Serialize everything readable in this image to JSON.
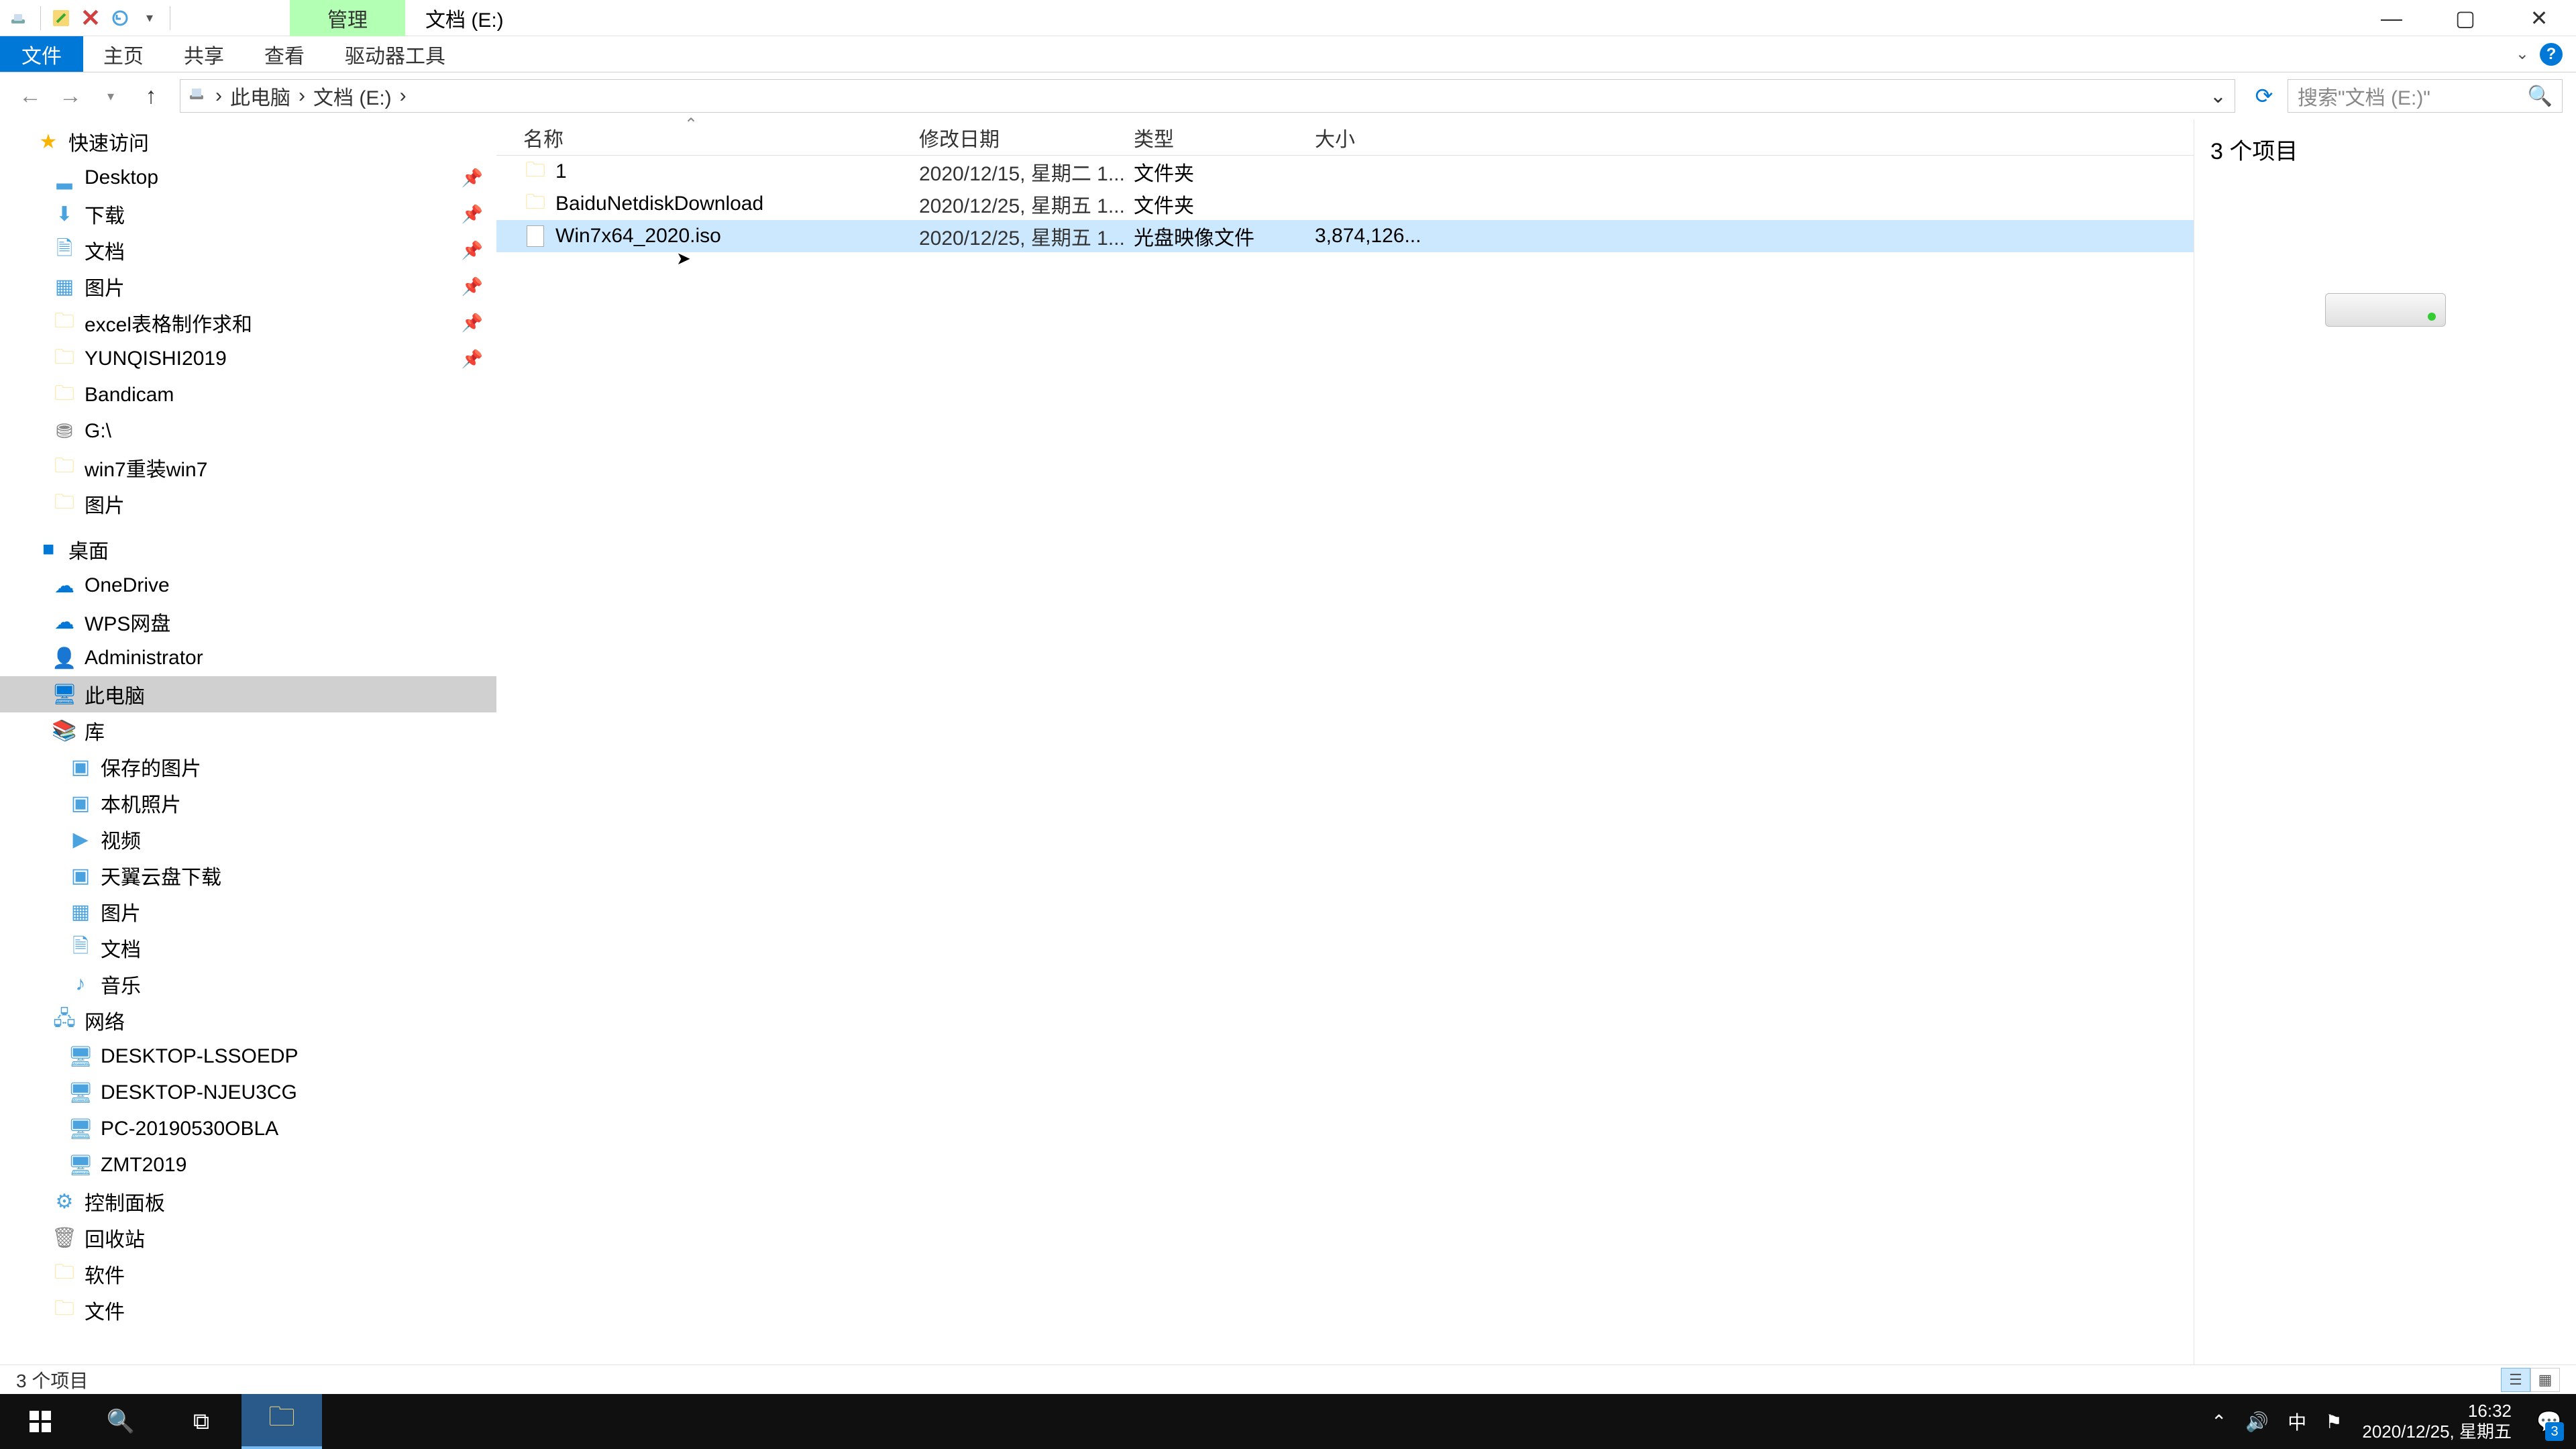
{
  "title_bar": {
    "contextual_label": "管理",
    "window_title": "文档 (E:)"
  },
  "ribbon": {
    "file": "文件",
    "home": "主页",
    "share": "共享",
    "view": "查看",
    "drive_tools": "驱动器工具"
  },
  "breadcrumb": {
    "root": "此电脑",
    "current": "文档 (E:)"
  },
  "search": {
    "placeholder": "搜索\"文档 (E:)\""
  },
  "columns": {
    "name": "名称",
    "date": "修改日期",
    "type": "类型",
    "size": "大小"
  },
  "files": [
    {
      "icon": "folder",
      "name": "1",
      "date": "2020/12/15, 星期二 1...",
      "type": "文件夹",
      "size": ""
    },
    {
      "icon": "folder",
      "name": "BaiduNetdiskDownload",
      "date": "2020/12/25, 星期五 1...",
      "type": "文件夹",
      "size": ""
    },
    {
      "icon": "file",
      "name": "Win7x64_2020.iso",
      "date": "2020/12/25, 星期五 1...",
      "type": "光盘映像文件",
      "size": "3,874,126..."
    }
  ],
  "nav": {
    "quick_access": "快速访问",
    "qa_items": [
      {
        "label": "Desktop",
        "icon": "desktop",
        "pinned": true
      },
      {
        "label": "下载",
        "icon": "downloads",
        "pinned": true
      },
      {
        "label": "文档",
        "icon": "documents",
        "pinned": true
      },
      {
        "label": "图片",
        "icon": "pictures",
        "pinned": true
      },
      {
        "label": "excel表格制作求和",
        "icon": "folder",
        "pinned": true
      },
      {
        "label": "YUNQISHI2019",
        "icon": "folder",
        "pinned": true
      },
      {
        "label": "Bandicam",
        "icon": "folder",
        "pinned": false
      },
      {
        "label": "G:\\",
        "icon": "drive",
        "pinned": false
      },
      {
        "label": "win7重装win7",
        "icon": "folder",
        "pinned": false
      },
      {
        "label": "图片",
        "icon": "folder",
        "pinned": false
      }
    ],
    "desktop": "桌面",
    "onedrive": "OneDrive",
    "wps": "WPS网盘",
    "admin": "Administrator",
    "thispc": "此电脑",
    "libraries": "库",
    "lib_items": [
      "保存的图片",
      "本机照片",
      "视频",
      "天翼云盘下载",
      "图片",
      "文档",
      "音乐"
    ],
    "network": "网络",
    "net_items": [
      "DESKTOP-LSSOEDP",
      "DESKTOP-NJEU3CG",
      "PC-20190530OBLA",
      "ZMT2019"
    ],
    "control_panel": "控制面板",
    "recycle": "回收站",
    "software": "软件",
    "files_folder": "文件"
  },
  "preview": {
    "count_label": "3 个项目"
  },
  "status": {
    "items": "3 个项目"
  },
  "taskbar": {
    "time": "16:32",
    "date": "2020/12/25, 星期五",
    "ime": "中",
    "notif_count": "3"
  }
}
